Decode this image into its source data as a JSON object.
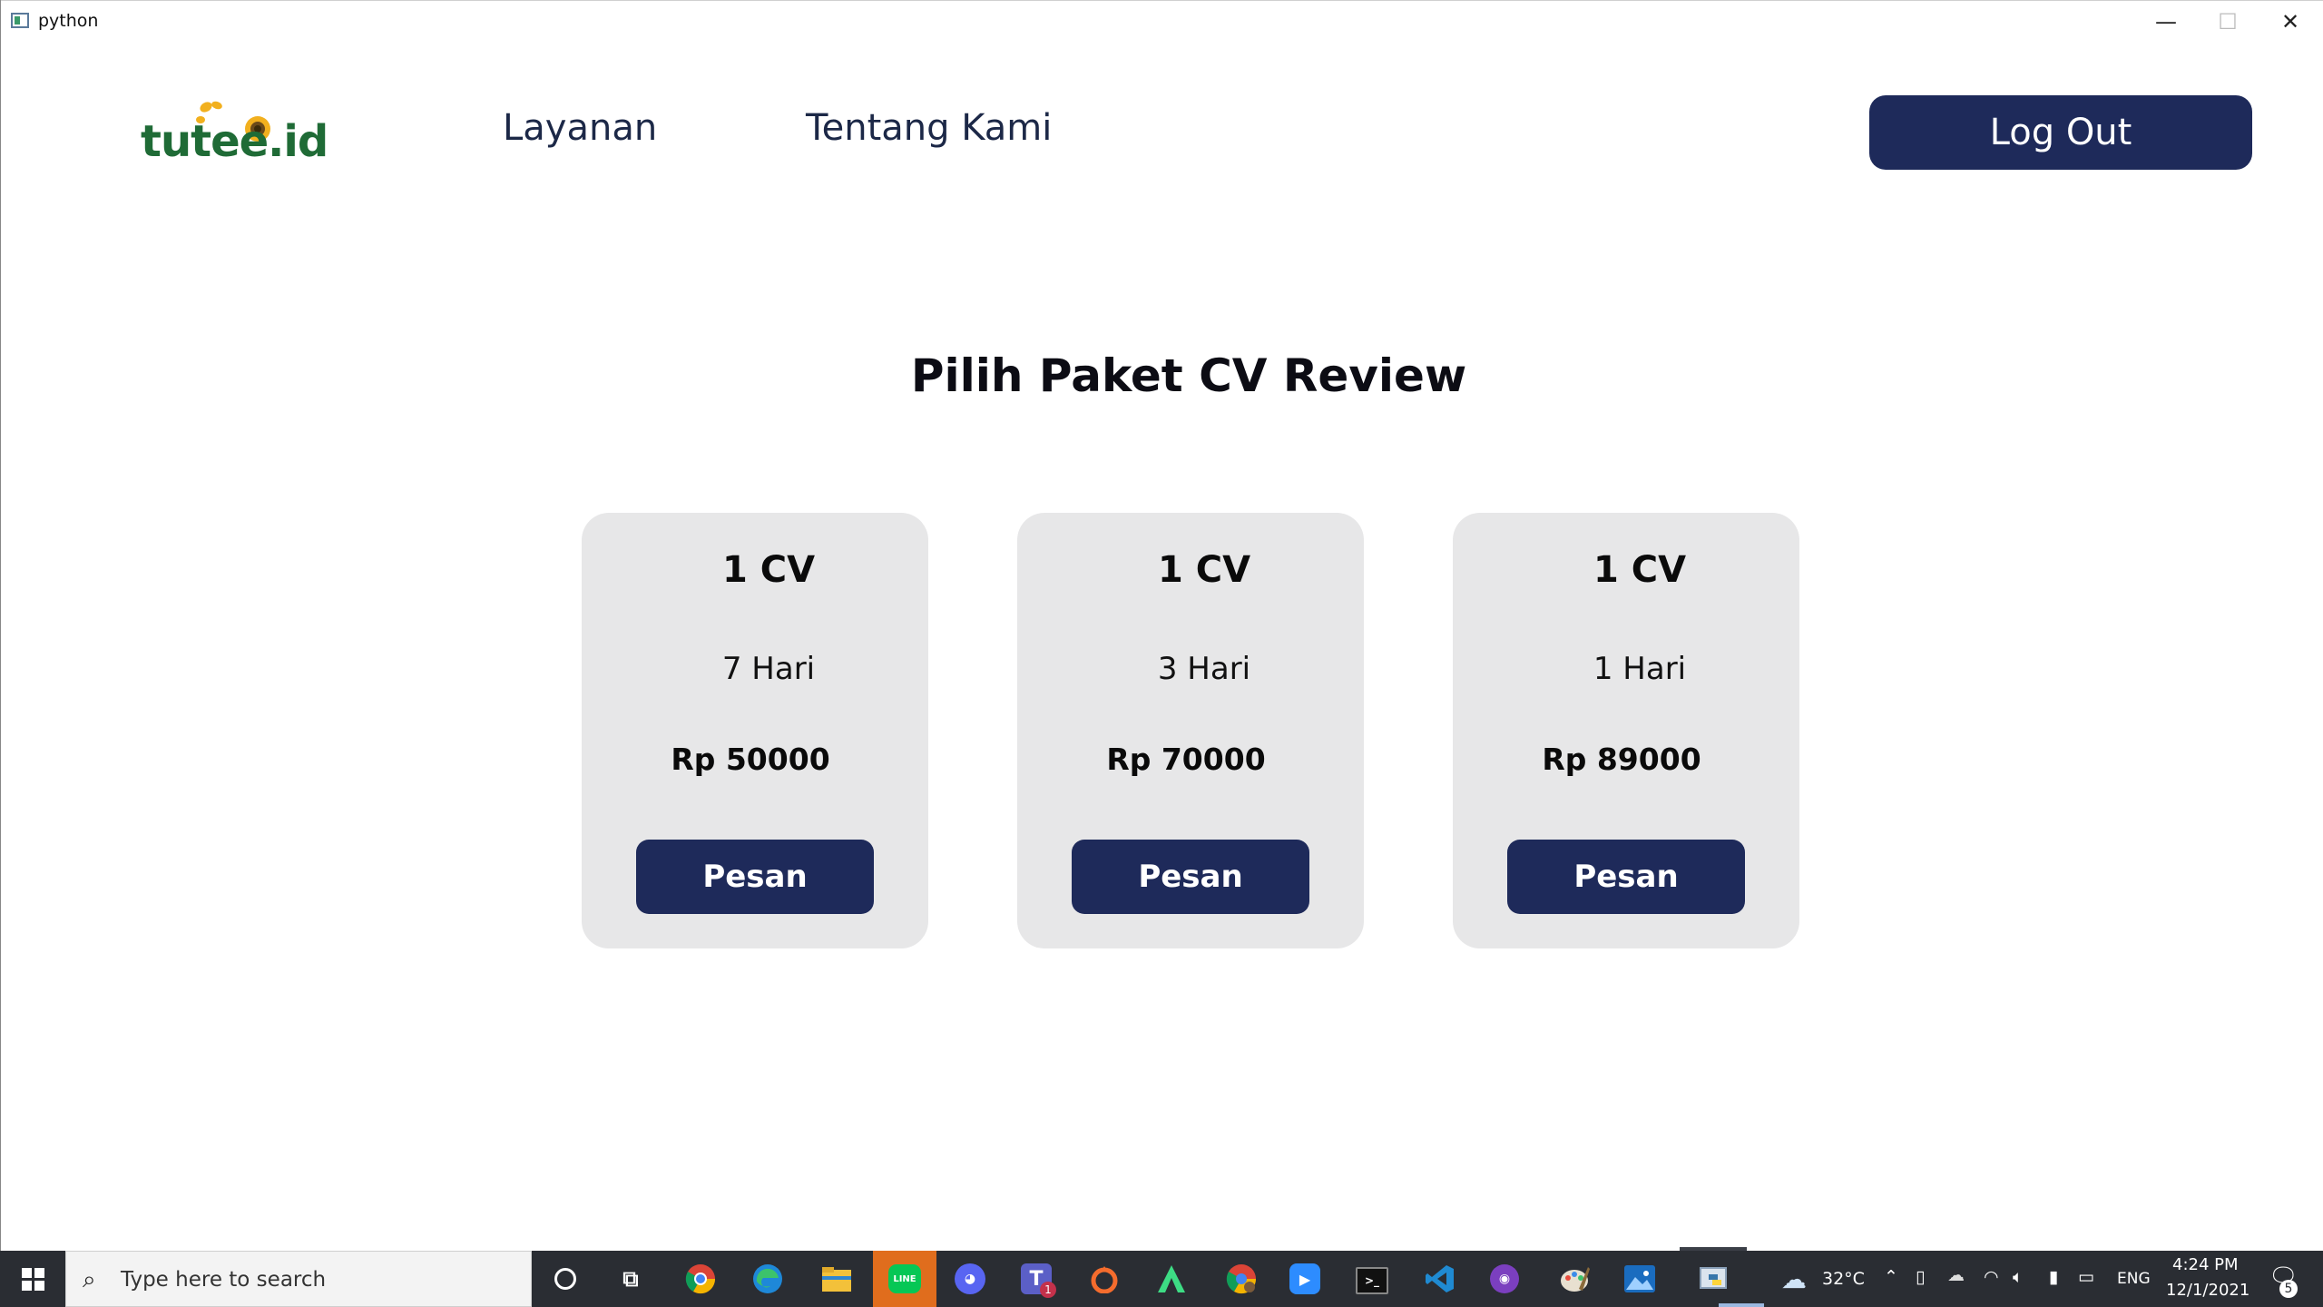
{
  "window": {
    "title": "python",
    "minimize_glyph": "—",
    "maximize_glyph": "☐",
    "close_glyph": "✕"
  },
  "header": {
    "logo_text": "tutee.id",
    "nav": [
      {
        "label": "Layanan"
      },
      {
        "label": "Tentang Kami"
      }
    ],
    "logout_label": "Log Out"
  },
  "main": {
    "title": "Pilih Paket CV Review",
    "packages": [
      {
        "qty": "1 CV",
        "duration": "7 Hari",
        "price": "Rp 50000",
        "button": "Pesan"
      },
      {
        "qty": "1 CV",
        "duration": "3 Hari",
        "price": "Rp 70000",
        "button": "Pesan"
      },
      {
        "qty": "1 CV",
        "duration": "1 Hari",
        "price": "Rp 89000",
        "button": "Pesan"
      }
    ]
  },
  "taskbar": {
    "search_placeholder": "Type here to search",
    "weather": "32°C",
    "language": "ENG",
    "time": "4:24 PM",
    "date": "12/1/2021",
    "notification_count": "5",
    "teams_badge": "1",
    "apps": [
      "task-view",
      "chrome",
      "edge",
      "file-explorer",
      "line",
      "discord",
      "teams",
      "origin",
      "android-studio",
      "chrome-profile",
      "zoom",
      "terminal",
      "vscode",
      "github-desktop",
      "paint",
      "photos",
      "python"
    ]
  },
  "colors": {
    "primary": "#1e2a5a",
    "card_bg": "#e7e7e8",
    "logo_green": "#1f6b36",
    "logo_yellow": "#f2b01e",
    "taskbar_bg": "#2a2d33"
  }
}
